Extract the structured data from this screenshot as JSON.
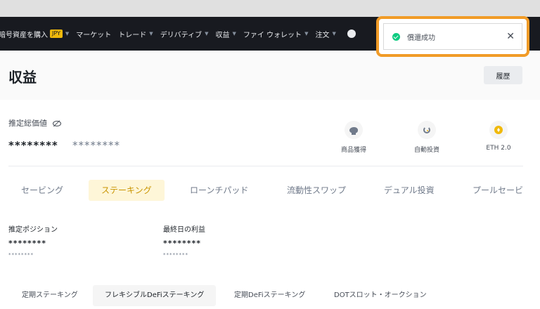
{
  "navbar": {
    "items": [
      {
        "label": "暗号資産を購入",
        "badge": "JPY",
        "has_caret": true
      },
      {
        "label": "マーケット",
        "has_caret": false
      },
      {
        "label": "トレード",
        "has_caret": true
      },
      {
        "label": "デリバティブ",
        "has_caret": true
      },
      {
        "label": "収益",
        "has_caret": true
      },
      {
        "label": "ファイ ウォレット",
        "has_caret": true
      },
      {
        "label": "注文",
        "has_caret": true
      }
    ]
  },
  "toast": {
    "message": "償還成功",
    "close": "✕"
  },
  "page": {
    "title": "収益",
    "history_button": "履歴"
  },
  "estimate": {
    "label": "推定総価値",
    "masked_value": "********",
    "masked_secondary": "********"
  },
  "quick_actions": [
    {
      "label": "商品獲得",
      "icon": "piggy-bank-icon"
    },
    {
      "label": "自動投資",
      "icon": "auto-invest-icon"
    },
    {
      "label": "ETH 2.0",
      "icon": "eth-icon"
    }
  ],
  "tabs": [
    {
      "label": "セービング",
      "active": false
    },
    {
      "label": "ステーキング",
      "active": true
    },
    {
      "label": "ローンチパッド",
      "active": false
    },
    {
      "label": "流動性スワップ",
      "active": false
    },
    {
      "label": "デュアル投資",
      "active": false
    },
    {
      "label": "プールセービ",
      "active": false
    }
  ],
  "positions": [
    {
      "label": "推定ポジション",
      "masked": "********",
      "masked_small": "********"
    },
    {
      "label": "最終日の利益",
      "masked": "********",
      "masked_small": "********"
    }
  ],
  "subtabs": [
    {
      "label": "定期ステーキング",
      "active": false
    },
    {
      "label": "フレキシブルDeFiステーキング",
      "active": true
    },
    {
      "label": "定期DeFiステーキング",
      "active": false
    },
    {
      "label": "DOTスロット・オークション",
      "active": false
    }
  ],
  "colors": {
    "accent": "#f0b90b",
    "highlight": "#f19b27",
    "success": "#0ecb81",
    "nav_bg": "#181a20"
  }
}
